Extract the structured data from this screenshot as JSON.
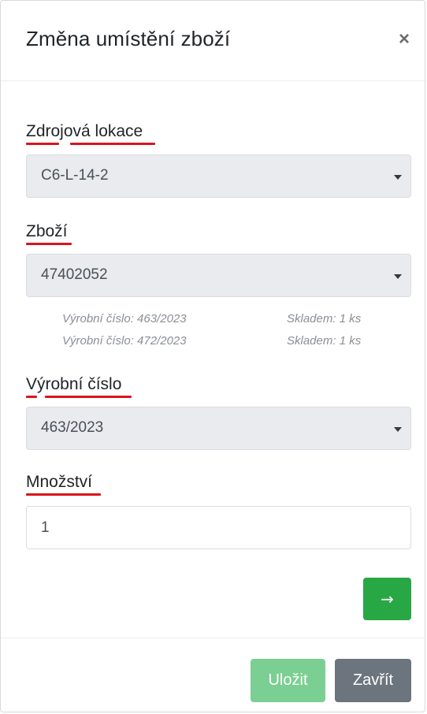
{
  "modal": {
    "title": "Změna umístění zboží",
    "close_symbol": "×",
    "close_icon": "close-icon"
  },
  "form": {
    "source_location": {
      "label": "Zdrojová lokace",
      "value": "C6-L-14-2"
    },
    "goods": {
      "label": "Zboží",
      "value": "47402052",
      "hints": [
        {
          "serial": "Výrobní číslo: 463/2023",
          "stock": "Skladem: 1 ks"
        },
        {
          "serial": "Výrobní číslo: 472/2023",
          "stock": "Skladem: 1 ks"
        }
      ]
    },
    "serial_number": {
      "label": "Výrobní číslo",
      "value": "463/2023"
    },
    "quantity": {
      "label": "Množství",
      "value": "1"
    },
    "next_button": {
      "icon": "arrow-right-icon",
      "symbol": "→"
    }
  },
  "footer": {
    "save_label": "Uložit",
    "close_label": "Zavřít"
  },
  "colors": {
    "success": "#28a745",
    "success_disabled": "#7ccf92",
    "secondary": "#6c757d",
    "spellcheck_underline": "#d9141c"
  }
}
